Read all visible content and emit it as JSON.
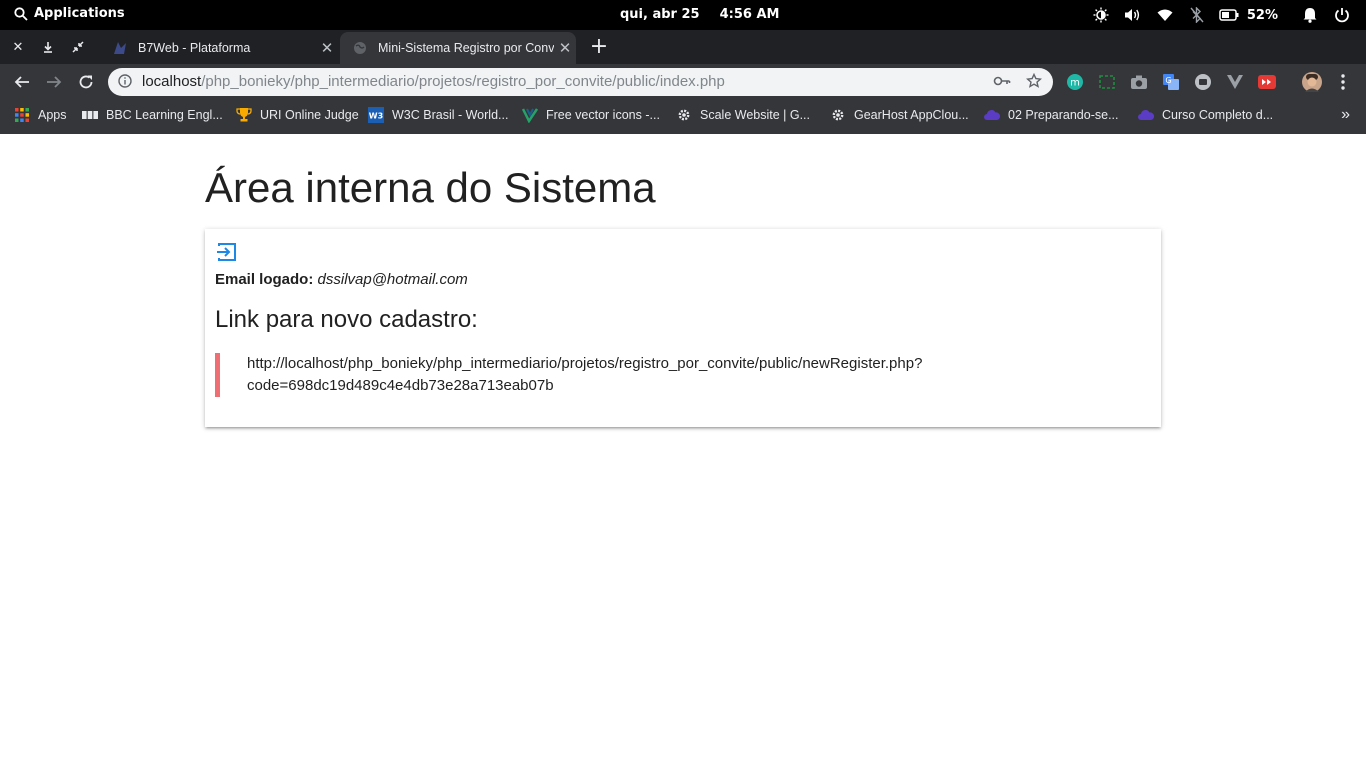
{
  "os_panel": {
    "apps_label": "Applications",
    "date": "qui, abr 25",
    "time": "4:56 AM",
    "battery_percent": "52%"
  },
  "tabs": [
    {
      "title": "B7Web - Plataforma"
    },
    {
      "title": "Mini-Sistema Registro por Convite"
    }
  ],
  "address_bar": {
    "host": "localhost",
    "path": "/php_bonieky/php_intermediario/projetos/registro_por_convite/public/index.php"
  },
  "bookmarks": [
    {
      "label": "Apps",
      "icon": "apps-grid-icon"
    },
    {
      "label": "BBC Learning Engl...",
      "icon": "bbc-icon"
    },
    {
      "label": "URI Online Judge",
      "icon": "trophy-icon"
    },
    {
      "label": "W3C Brasil - World...",
      "icon": "w3c-icon"
    },
    {
      "label": "Free vector icons -...",
      "icon": "vector-icon"
    },
    {
      "label": "Scale Website | G...",
      "icon": "gear-icon"
    },
    {
      "label": "GearHost AppClou...",
      "icon": "gear-icon"
    },
    {
      "label": "02 Preparando-se...",
      "icon": "cloud-icon"
    },
    {
      "label": "Curso Completo d...",
      "icon": "cloud-icon"
    }
  ],
  "page": {
    "heading": "Área interna do Sistema",
    "email_label": "Email logado:",
    "email_value": "dssilvap@hotmail.com",
    "subheading": "Link para novo cadastro:",
    "link_line1": "http://localhost/php_bonieky/php_intermediario/projetos/registro_por_convite/public/newRegister.php?",
    "link_line2": "code=698dc19d489c4e4db73e28a713eab07b"
  },
  "colors": {
    "accent_blue": "#1e88e5",
    "quote_border": "#ee6e73"
  }
}
